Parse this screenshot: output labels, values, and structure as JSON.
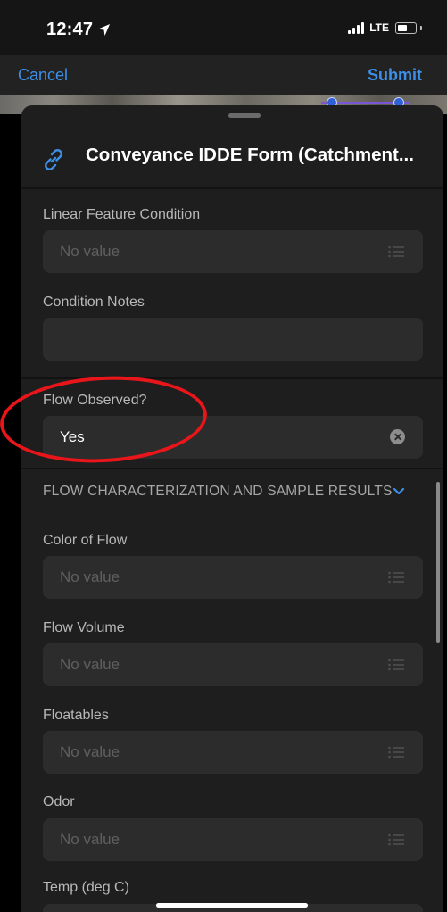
{
  "status_bar": {
    "time": "12:47",
    "carrier": "LTE"
  },
  "nav": {
    "cancel_label": "Cancel",
    "submit_label": "Submit"
  },
  "form": {
    "title": "Conveyance IDDE Form (Catchment...",
    "fields": [
      {
        "label": "Linear Feature Condition",
        "value": "No value"
      },
      {
        "label": "Condition Notes",
        "value": ""
      },
      {
        "label": "Flow Observed?",
        "value": "Yes"
      }
    ],
    "section_title": "FLOW CHARACTERIZATION AND SAMPLE RESULTS",
    "section_fields": [
      {
        "label": "Color of Flow",
        "value": "No value"
      },
      {
        "label": "Flow Volume",
        "value": "No value"
      },
      {
        "label": "Floatables",
        "value": "No value"
      },
      {
        "label": "Odor",
        "value": "No value"
      },
      {
        "label": "Temp (deg C)",
        "value": ""
      }
    ]
  },
  "colors": {
    "accent": "#3d8fe6",
    "sheet": "#1e1e1e",
    "field": "#2c2c2c",
    "annotation": "#e8161b"
  },
  "icons": [
    "location-arrow-icon",
    "signal-icon",
    "battery-icon",
    "link-icon",
    "list-icon",
    "clear-icon",
    "chevron-down-icon"
  ]
}
